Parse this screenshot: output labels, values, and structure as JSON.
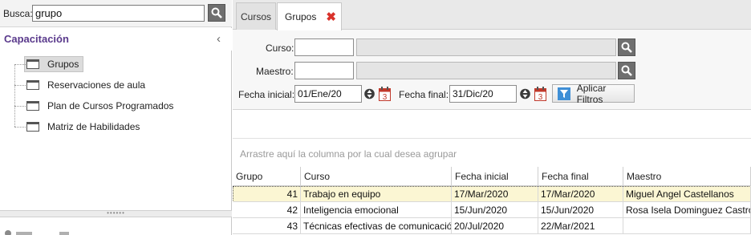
{
  "sidebar": {
    "search_label": "Busca:",
    "search_value": "grupo",
    "section_title": "Capacitación",
    "tree": [
      {
        "label": "Grupos",
        "selected": true
      },
      {
        "label": "Reservaciones de aula",
        "selected": false
      },
      {
        "label": "Plan de Cursos Programados",
        "selected": false
      },
      {
        "label": "Matriz de Habilidades",
        "selected": false
      }
    ],
    "splitter_grip": "••••••"
  },
  "tabs": [
    {
      "label": "Cursos",
      "active": false
    },
    {
      "label": "Grupos",
      "active": true
    }
  ],
  "filters": {
    "curso_label": "Curso:",
    "curso_value": "",
    "maestro_label": "Maestro:",
    "maestro_value": "",
    "fecha_inicial_label": "Fecha inicial:",
    "fecha_inicial_value": "01/Ene/20",
    "fecha_final_label": "Fecha final:",
    "fecha_final_value": "31/Dic/20",
    "calendar_day": "3",
    "apply_label": "Aplicar Filtros"
  },
  "grid": {
    "group_hint": "Arrastre aquí la columna por la cual desea agrupar",
    "columns": [
      "Grupo",
      "Curso",
      "Fecha inicial",
      "Fecha final",
      "Maestro"
    ],
    "rows": [
      {
        "grupo": "41",
        "curso": "Trabajo en equipo",
        "fecha_inicial": "17/Mar/2020",
        "fecha_final": "17/Mar/2020",
        "maestro": "Miguel Angel Castellanos"
      },
      {
        "grupo": "42",
        "curso": "Inteligencia emocional",
        "fecha_inicial": "15/Jun/2020",
        "fecha_final": "15/Jun/2020",
        "maestro": "Rosa Isela Dominguez Castro"
      },
      {
        "grupo": "43",
        "curso": "Técnicas efectivas de comunicación",
        "fecha_inicial": "20/Jul/2020",
        "fecha_final": "22/Mar/2021",
        "maestro": ""
      }
    ]
  },
  "colors": {
    "section_title": "#5a3a8c",
    "search_button": "#6f6f6f",
    "close_icon": "#d9322b",
    "selected_row": "#fbf6d3",
    "filter_icon": "#3f8fd6"
  }
}
